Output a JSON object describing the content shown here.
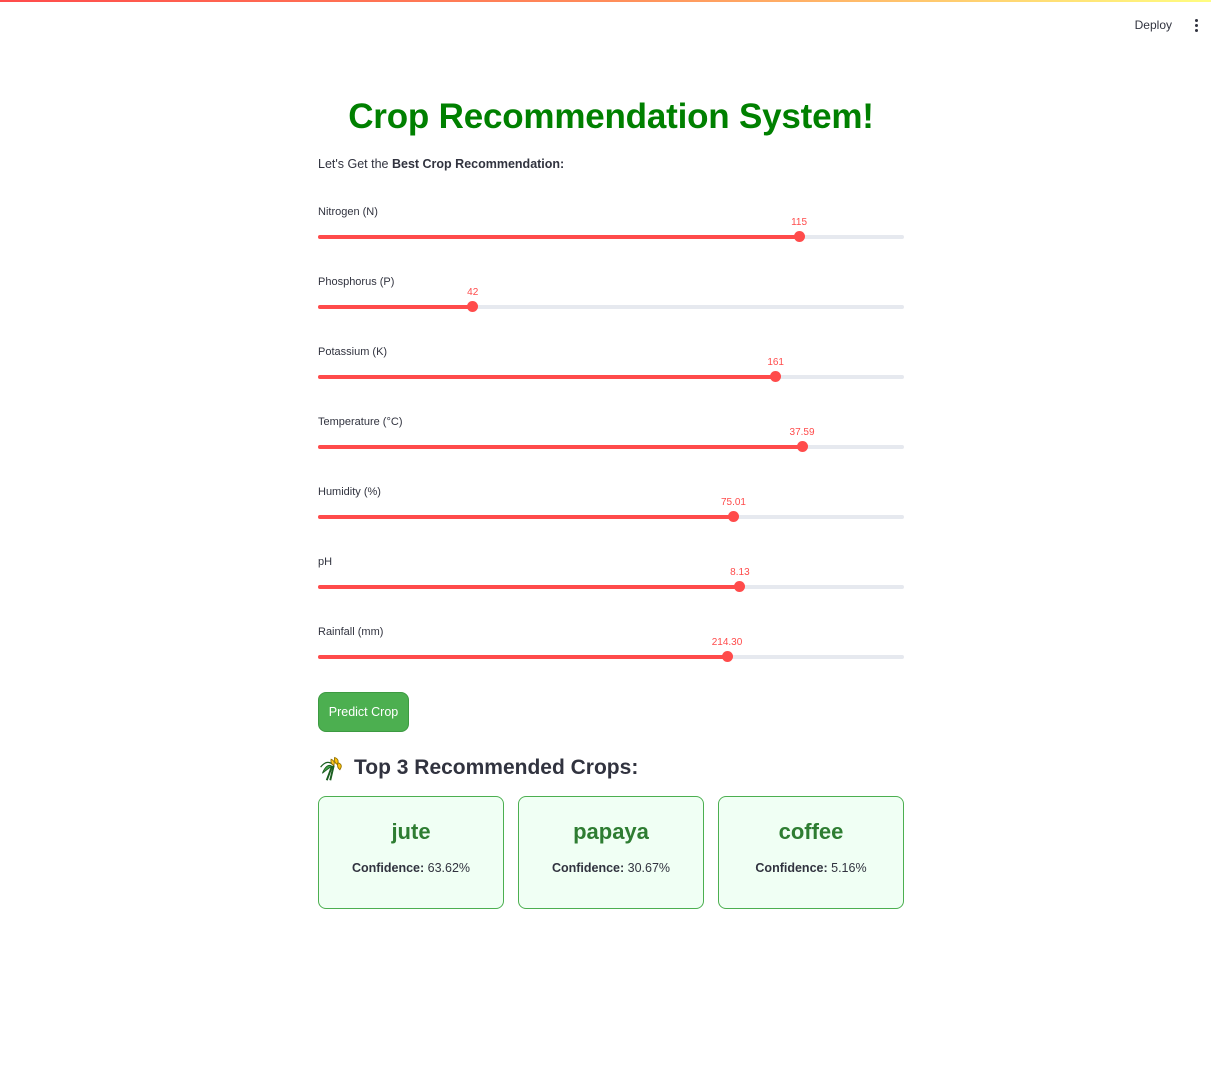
{
  "header": {
    "deploy_label": "Deploy",
    "menu_icon": "vertical-dots-icon"
  },
  "page": {
    "title": "Crop Recommendation System!",
    "subtitle_prefix": "Let's Get the ",
    "subtitle_bold": "Best Crop Recommendation:"
  },
  "colors": {
    "accent": "#ff4b4b",
    "title_green": "#008000",
    "button_green": "#4caf50",
    "card_border": "#4caf50",
    "card_bg": "#f0fff4",
    "crop_name": "#2e7d32"
  },
  "sliders": [
    {
      "label": "Nitrogen (N)",
      "value": "115",
      "fraction": 0.821
    },
    {
      "label": "Phosphorus (P)",
      "value": "42",
      "fraction": 0.264
    },
    {
      "label": "Potassium (K)",
      "value": "161",
      "fraction": 0.781
    },
    {
      "label": "Temperature (°C)",
      "value": "37.59",
      "fraction": 0.826
    },
    {
      "label": "Humidity (%)",
      "value": "75.01",
      "fraction": 0.709
    },
    {
      "label": "pH",
      "value": "8.13",
      "fraction": 0.72
    },
    {
      "label": "Rainfall (mm)",
      "value": "214.30",
      "fraction": 0.698
    }
  ],
  "predict_button": {
    "label": "Predict Crop"
  },
  "results": {
    "icon": "sheaf-of-rice-icon",
    "heading": "Top 3 Recommended Crops:",
    "confidence_label": "Confidence:",
    "crops": [
      {
        "name": "jute",
        "confidence": "63.62%"
      },
      {
        "name": "papaya",
        "confidence": "30.67%"
      },
      {
        "name": "coffee",
        "confidence": "5.16%"
      }
    ]
  }
}
